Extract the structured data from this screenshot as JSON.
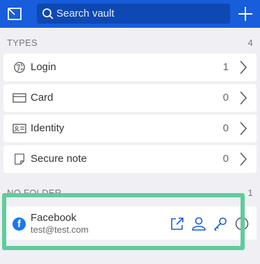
{
  "header": {
    "search_placeholder": "Search vault",
    "popout_icon": "popout-icon",
    "add_icon": "plus-icon",
    "color": "#175ddc"
  },
  "types": {
    "heading": "TYPES",
    "count": "4",
    "items": [
      {
        "label": "Login",
        "count": "1",
        "icon": "globe-icon"
      },
      {
        "label": "Card",
        "count": "0",
        "icon": "credit-card-icon"
      },
      {
        "label": "Identity",
        "count": "0",
        "icon": "id-card-icon"
      },
      {
        "label": "Secure note",
        "count": "0",
        "icon": "note-icon"
      }
    ]
  },
  "no_folder": {
    "heading": "NO FOLDER",
    "count": "1",
    "item": {
      "name": "Facebook",
      "username": "test@test.com",
      "icon": "facebook-icon",
      "icon_letter": "f",
      "actions": [
        "launch-icon",
        "user-icon",
        "key-icon",
        "clock-icon"
      ]
    }
  },
  "highlight_color": "#5fcc9c"
}
